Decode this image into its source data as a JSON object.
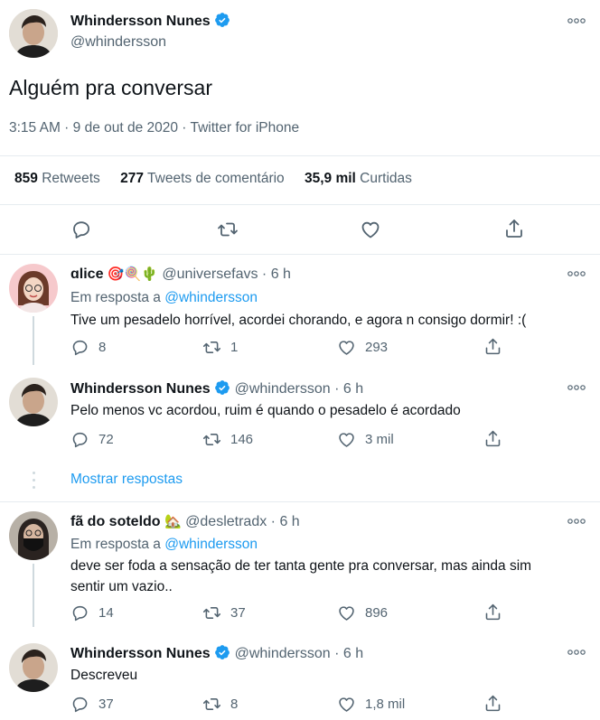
{
  "main_tweet": {
    "author_name": "Whindersson Nunes",
    "handle": "@whindersson",
    "text": "Alguém pra conversar",
    "meta": "3:15 AM · 9 de out de 2020 · Twitter for iPhone",
    "stats": {
      "retweets_count": "859",
      "retweets_label": "Retweets",
      "quotes_count": "277",
      "quotes_label": "Tweets de comentário",
      "likes_count": "35,9 mil",
      "likes_label": "Curtidas"
    }
  },
  "replies": [
    {
      "author_name": "ɑlice",
      "emojis": "🎯🍭🌵",
      "handle": "@universefavs",
      "time": "· 6 h",
      "reply_prefix": "Em resposta a",
      "reply_to": "@whindersson",
      "text": "Tive um pesadelo horrível, acordei chorando, e agora n consigo dormir! :(",
      "replies": "8",
      "retweets": "1",
      "likes": "293"
    },
    {
      "author_name": "Whindersson Nunes",
      "handle": "@whindersson",
      "time": "· 6 h",
      "text": "Pelo menos vc acordou, ruim é quando o pesadelo é acordado",
      "replies": "72",
      "retweets": "146",
      "likes": "3 mil"
    },
    {
      "author_name": "fã do soteldo",
      "emojis": "🏡",
      "handle": "@desletradx",
      "time": "· 6 h",
      "reply_prefix": "Em resposta a",
      "reply_to": "@whindersson",
      "text_line1": "deve ser foda a sensação de ter tanta gente pra conversar, mas ainda sim",
      "text_line2": "sentir um vazio..",
      "replies": "14",
      "retweets": "37",
      "likes": "896"
    },
    {
      "author_name": "Whindersson Nunes",
      "handle": "@whindersson",
      "time": "· 6 h",
      "text": "Descreveu",
      "replies": "37",
      "retweets": "8",
      "likes": "1,8 mil"
    }
  ],
  "show_replies_label": "Mostrar respostas",
  "icons": [
    "verified-badge-icon",
    "more-icon",
    "reply-icon",
    "retweet-icon",
    "like-icon",
    "share-icon"
  ],
  "colors": {
    "accent": "#1d9bf0",
    "text": "#0f1419",
    "secondary": "#536471",
    "divider": "#e6ecf0"
  }
}
